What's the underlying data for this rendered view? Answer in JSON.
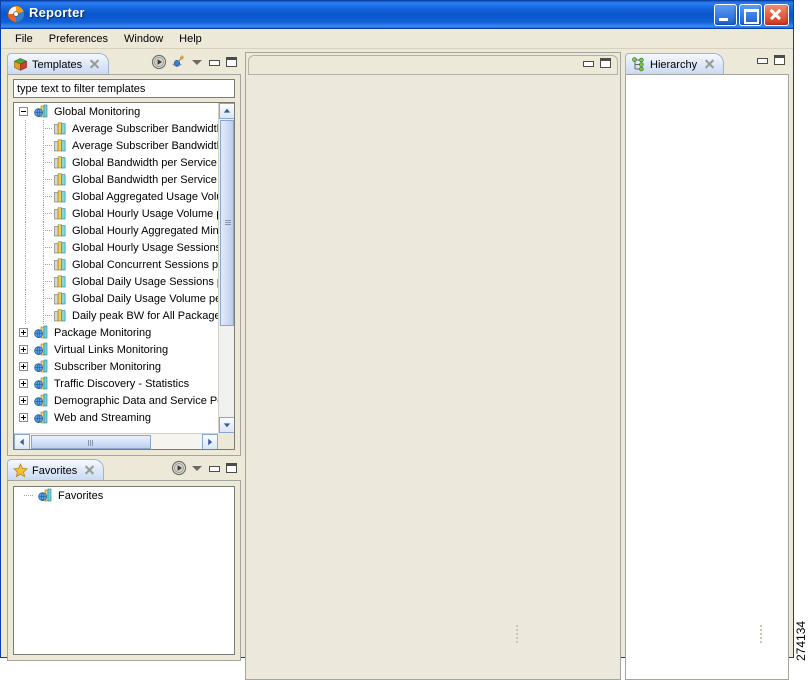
{
  "window": {
    "title": "Reporter",
    "icon": "reporter-app-icon",
    "buttons": {
      "minimize": "Minimize",
      "maximize": "Maximize",
      "close": "Close"
    }
  },
  "menubar": {
    "items": [
      "File",
      "Preferences",
      "Window",
      "Help"
    ]
  },
  "templates_view": {
    "tab_label": "Templates",
    "tab_icon": "templates-cube-icon",
    "close_label": "Close",
    "toolbar": [
      {
        "name": "run-report-icon",
        "title": "Run"
      },
      {
        "name": "new-report-icon",
        "title": "New Report"
      },
      {
        "name": "view-menu-icon",
        "title": "View Menu"
      },
      {
        "name": "minimize-icon",
        "title": "Minimize"
      },
      {
        "name": "maximize-icon",
        "title": "Maximize"
      }
    ],
    "filter_placeholder": "type text to filter templates",
    "filter_value": "",
    "tree": [
      {
        "label": "Global Monitoring",
        "level": 0,
        "expanded": true,
        "icon": "group-globe-icon"
      },
      {
        "label": "Average Subscriber Bandwidth",
        "level": 1,
        "icon": "report-chart-icon"
      },
      {
        "label": "Average Subscriber Bandwidth",
        "level": 1,
        "icon": "report-chart-icon"
      },
      {
        "label": "Global Bandwidth per Service",
        "level": 1,
        "icon": "report-chart-icon"
      },
      {
        "label": "Global Bandwidth per Service",
        "level": 1,
        "icon": "report-chart-icon"
      },
      {
        "label": "Global Aggregated Usage Volume",
        "level": 1,
        "icon": "report-chart-icon"
      },
      {
        "label": "Global Hourly Usage Volume per",
        "level": 1,
        "icon": "report-chart-icon"
      },
      {
        "label": "Global Hourly Aggregated Minu",
        "level": 1,
        "icon": "report-chart-icon"
      },
      {
        "label": "Global Hourly Usage Sessions",
        "level": 1,
        "icon": "report-chart-icon"
      },
      {
        "label": "Global Concurrent Sessions pe",
        "level": 1,
        "icon": "report-chart-icon"
      },
      {
        "label": "Global Daily Usage Sessions pe",
        "level": 1,
        "icon": "report-chart-icon"
      },
      {
        "label": "Global Daily Usage Volume per",
        "level": 1,
        "icon": "report-chart-icon"
      },
      {
        "label": "Daily peak BW for All Packages",
        "level": 1,
        "icon": "report-chart-icon"
      },
      {
        "label": "Package Monitoring",
        "level": 0,
        "expanded": false,
        "icon": "group-globe-icon"
      },
      {
        "label": "Virtual Links Monitoring",
        "level": 0,
        "expanded": false,
        "icon": "group-globe-icon"
      },
      {
        "label": "Subscriber Monitoring",
        "level": 0,
        "expanded": false,
        "icon": "group-globe-icon"
      },
      {
        "label": "Traffic Discovery - Statistics",
        "level": 0,
        "expanded": false,
        "icon": "group-globe-icon"
      },
      {
        "label": "Demographic Data and Service Po",
        "level": 0,
        "expanded": false,
        "icon": "group-globe-icon"
      },
      {
        "label": "Web and Streaming",
        "level": 0,
        "expanded": false,
        "icon": "group-globe-icon"
      }
    ]
  },
  "favorites_view": {
    "tab_label": "Favorites",
    "tab_icon": "favorites-star-icon",
    "close_label": "Close",
    "toolbar": [
      {
        "name": "run-report-icon",
        "title": "Run"
      },
      {
        "name": "view-menu-icon",
        "title": "View Menu"
      },
      {
        "name": "minimize-icon",
        "title": "Minimize"
      },
      {
        "name": "maximize-icon",
        "title": "Maximize"
      }
    ],
    "tree": [
      {
        "label": "Favorites",
        "level": 0,
        "icon": "group-globe-icon"
      }
    ]
  },
  "editor_area": {
    "toolbar": [
      {
        "name": "minimize-icon",
        "title": "Minimize"
      },
      {
        "name": "maximize-icon",
        "title": "Maximize"
      }
    ]
  },
  "hierarchy_view": {
    "tab_label": "Hierarchy",
    "tab_icon": "hierarchy-tree-icon",
    "close_label": "Close",
    "toolbar": [
      {
        "name": "minimize-icon",
        "title": "Minimize"
      },
      {
        "name": "maximize-icon",
        "title": "Maximize"
      }
    ],
    "content": ""
  },
  "watermark": {
    "text": "274134"
  },
  "colors": {
    "titlebar_blue": "#0a55cc",
    "chrome_beige": "#ece9d8",
    "tab_blue": "#c9d9f2",
    "editor_bg": "#ece9dc",
    "white": "#ffffff"
  }
}
